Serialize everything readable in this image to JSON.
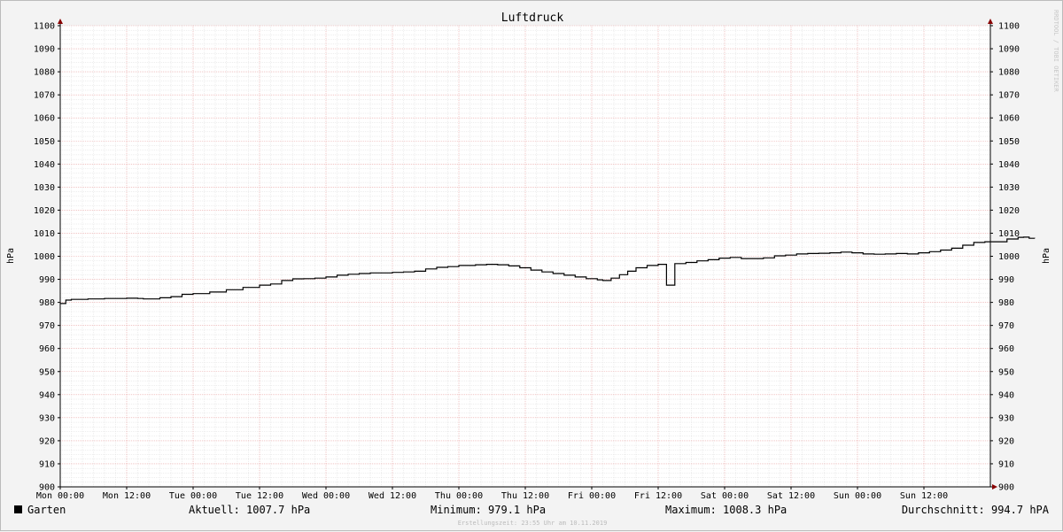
{
  "chart_data": {
    "type": "line",
    "title": "Luftdruck",
    "ylabel": "hPa",
    "ylabel_right": "hPa",
    "ylim": [
      900,
      1100
    ],
    "y_ticks": [
      900,
      910,
      920,
      930,
      940,
      950,
      960,
      970,
      980,
      990,
      1000,
      1010,
      1020,
      1030,
      1040,
      1050,
      1060,
      1070,
      1080,
      1090,
      1100
    ],
    "x_tick_labels": [
      "Mon 00:00",
      "Mon 12:00",
      "Tue 00:00",
      "Tue 12:00",
      "Wed 00:00",
      "Wed 12:00",
      "Thu 00:00",
      "Thu 12:00",
      "Fri 00:00",
      "Fri 12:00",
      "Sat 00:00",
      "Sat 12:00",
      "Sun 00:00",
      "Sun 12:00"
    ],
    "x_unit": "hours since Mon 00:00",
    "xlim": [
      0,
      168
    ],
    "grid": true,
    "series": [
      {
        "name": "Garten",
        "color": "#000000",
        "points": [
          [
            0,
            979.5
          ],
          [
            1,
            981
          ],
          [
            2,
            981.3
          ],
          [
            5,
            981.5
          ],
          [
            8,
            981.7
          ],
          [
            12,
            981.8
          ],
          [
            14,
            981.7
          ],
          [
            15,
            981.5
          ],
          [
            18,
            982
          ],
          [
            20,
            982.5
          ],
          [
            22,
            983.5
          ],
          [
            24,
            983.8
          ],
          [
            27,
            984.5
          ],
          [
            30,
            985.5
          ],
          [
            33,
            986.5
          ],
          [
            36,
            987.5
          ],
          [
            38,
            988
          ],
          [
            40,
            989.5
          ],
          [
            42,
            990.2
          ],
          [
            44,
            990.3
          ],
          [
            46,
            990.5
          ],
          [
            48,
            991
          ],
          [
            50,
            991.8
          ],
          [
            52,
            992.2
          ],
          [
            54,
            992.5
          ],
          [
            56,
            992.8
          ],
          [
            60,
            993
          ],
          [
            62,
            993.2
          ],
          [
            64,
            993.5
          ],
          [
            66,
            994.5
          ],
          [
            68,
            995.2
          ],
          [
            70,
            995.5
          ],
          [
            72,
            996
          ],
          [
            75,
            996.3
          ],
          [
            77,
            996.5
          ],
          [
            79,
            996.3
          ],
          [
            81,
            995.8
          ],
          [
            83,
            995
          ],
          [
            85,
            994
          ],
          [
            87,
            993.2
          ],
          [
            89,
            992.5
          ],
          [
            91,
            991.8
          ],
          [
            93,
            991
          ],
          [
            95,
            990.3
          ],
          [
            97,
            989.8
          ],
          [
            98,
            989.5
          ],
          [
            99.5,
            990.5
          ],
          [
            101,
            992
          ],
          [
            102.5,
            993.5
          ],
          [
            104,
            995
          ],
          [
            106,
            996
          ],
          [
            108,
            996.5
          ],
          [
            109,
            996.5
          ],
          [
            109.5,
            987.5
          ],
          [
            110.5,
            987.5
          ],
          [
            111,
            996.8
          ],
          [
            113,
            997.3
          ],
          [
            115,
            998
          ],
          [
            117,
            998.5
          ],
          [
            119,
            999.2
          ],
          [
            121,
            999.5
          ],
          [
            123,
            999
          ],
          [
            125,
            999
          ],
          [
            127,
            999.3
          ],
          [
            129,
            1000.2
          ],
          [
            131,
            1000.5
          ],
          [
            133,
            1001
          ],
          [
            135,
            1001.2
          ],
          [
            137,
            1001.3
          ],
          [
            139,
            1001.5
          ],
          [
            141,
            1001.8
          ],
          [
            143,
            1001.5
          ],
          [
            145,
            1001
          ],
          [
            147,
            1000.9
          ],
          [
            149,
            1001
          ],
          [
            151,
            1001.2
          ],
          [
            153,
            1001
          ],
          [
            155,
            1001.5
          ],
          [
            157,
            1002
          ],
          [
            159,
            1002.7
          ],
          [
            161,
            1003.5
          ],
          [
            163,
            1004.8
          ],
          [
            165,
            1006
          ],
          [
            167,
            1006.3
          ],
          [
            169,
            1006.3
          ],
          [
            171,
            1007.5
          ],
          [
            173,
            1008.2
          ],
          [
            174,
            1008.3
          ],
          [
            175,
            1007.8
          ],
          [
            176,
            1007.7
          ]
        ]
      }
    ],
    "legend_position": "bottom-left"
  },
  "footer": {
    "legend_label": "Garten",
    "aktuell": "Aktuell: 1007.7 hPa",
    "minimum": "Minimum: 979.1 hPa",
    "maximum": "Maximum: 1008.3 hPa",
    "durchschnitt": "Durchschnitt: 994.7 hPA",
    "created": "Erstellungszeit: 23:55 Uhr am 10.11.2019"
  },
  "watermark": "RRDTOOL / TOBI OETIKER"
}
